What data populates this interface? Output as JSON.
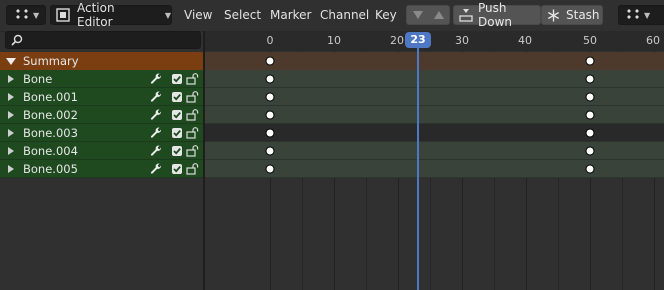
{
  "header": {
    "editor_type_icon": "dopesheet-icon",
    "mode_label": "Action Editor",
    "mode_icon": "action-editor-icon",
    "menus": [
      "View",
      "Select",
      "Marker",
      "Channel",
      "Key"
    ],
    "push_down_label": "Push Down",
    "stash_label": "Stash",
    "arrow_down_icon": "triangle-down-icon",
    "arrow_up_icon": "triangle-up-icon"
  },
  "search": {
    "icon": "search-icon",
    "placeholder": ""
  },
  "channels": {
    "summary": "Summary",
    "bones": [
      "Bone",
      "Bone.001",
      "Bone.002",
      "Bone.003",
      "Bone.004",
      "Bone.005"
    ]
  },
  "timeline": {
    "ticks": [
      "0",
      "10",
      "20",
      "30",
      "40",
      "50",
      "60"
    ],
    "current_frame": "23",
    "keyframes_at": [
      0,
      50
    ]
  },
  "colors": {
    "summary_channel": "#7b3e11",
    "bone_channel": "#1f4a1f",
    "playhead": "#4f78c4"
  }
}
